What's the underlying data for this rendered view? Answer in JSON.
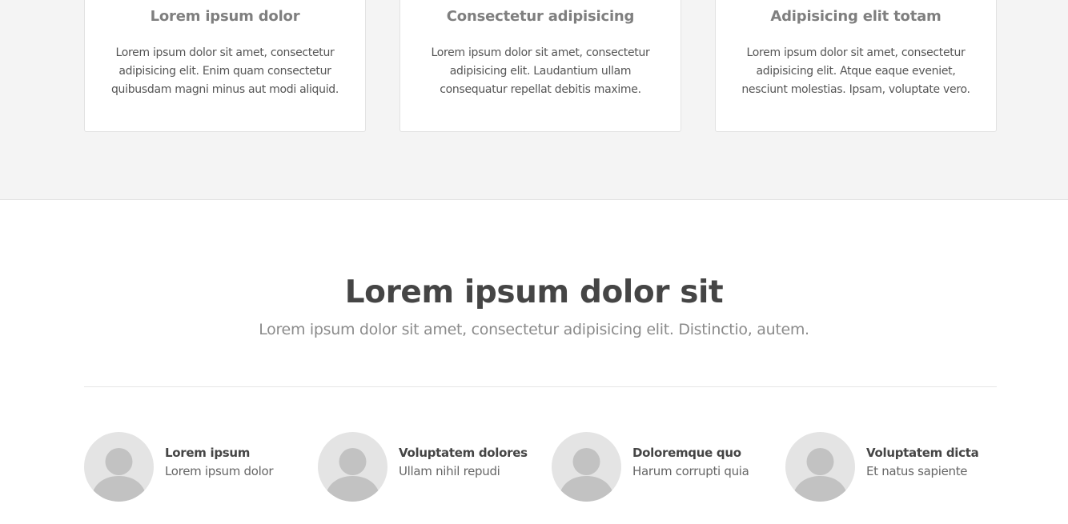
{
  "features": [
    {
      "title": "Lorem ipsum dolor",
      "text": "Lorem ipsum dolor sit amet, consectetur adipisicing elit. Enim quam consectetur quibusdam magni minus aut modi aliquid."
    },
    {
      "title": "Consectetur adipisicing",
      "text": "Lorem ipsum dolor sit amet, consectetur adipisicing elit. Laudantium ullam consequatur repellat debitis maxime."
    },
    {
      "title": "Adipisicing elit totam",
      "text": "Lorem ipsum dolor sit amet, consectetur adipisicing elit. Atque eaque eveniet, nesciunt molestias. Ipsam, voluptate vero."
    }
  ],
  "team_section": {
    "heading": "Lorem ipsum dolor sit",
    "subheading": "Lorem ipsum dolor sit amet, consectetur adipisicing elit. Distinctio, autem."
  },
  "team": [
    {
      "name": "Lorem ipsum",
      "role": "Lorem ipsum dolor",
      "avatar_icon": "user-placeholder-icon"
    },
    {
      "name": "Voluptatem dolores",
      "role": "Ullam nihil repudi",
      "avatar_icon": "user-placeholder-icon"
    },
    {
      "name": "Doloremque quo",
      "role": "Harum corrupti quia",
      "avatar_icon": "user-placeholder-icon"
    },
    {
      "name": "Voluptatem dicta",
      "role": "Et natus sapiente",
      "avatar_icon": "user-placeholder-icon"
    }
  ],
  "colors": {
    "band_bg": "#f4f4f4",
    "heading": "#454545",
    "muted": "#8b8b8b",
    "avatar_bg": "#e4e4e4",
    "avatar_figure": "#c2c2c2"
  }
}
